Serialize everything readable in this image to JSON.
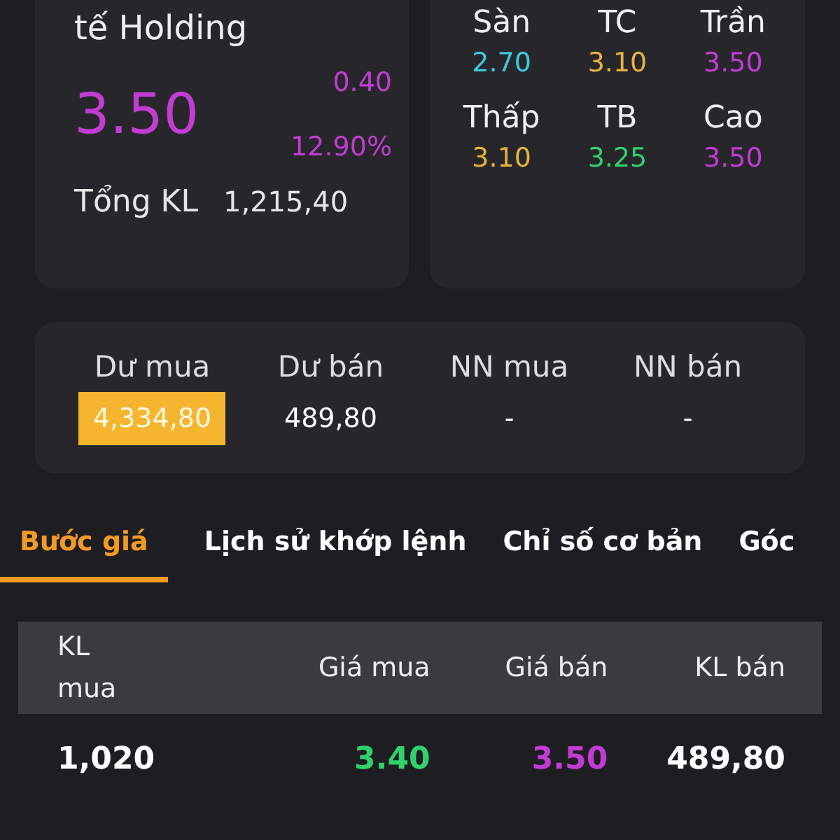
{
  "quote": {
    "name": "tế Holding",
    "price": {
      "text": "3.50",
      "kind": "ceiling"
    },
    "change": {
      "text": "0.40",
      "kind": "ceiling"
    },
    "percent": {
      "text": "12.90%",
      "kind": "ceiling"
    },
    "volume_label": "Tổng KL",
    "volume": "1,215,40"
  },
  "price_levels": [
    {
      "label": "Sàn",
      "value": "2.70",
      "kind": "floor"
    },
    {
      "label": "TC",
      "value": "3.10",
      "kind": "reference"
    },
    {
      "label": "Trần",
      "value": "3.50",
      "kind": "ceiling"
    },
    {
      "label": "Thấp",
      "value": "3.10",
      "kind": "reference"
    },
    {
      "label": "TB",
      "value": "3.25",
      "kind": "up"
    },
    {
      "label": "Cao",
      "value": "3.50",
      "kind": "ceiling"
    }
  ],
  "balances": [
    {
      "label": "Dư mua",
      "value": "4,334,80",
      "highlighted": true
    },
    {
      "label": "Dư bán",
      "value": "489,80",
      "highlighted": false
    },
    {
      "label": "NN mua",
      "value": "-",
      "highlighted": false
    },
    {
      "label": "NN bán",
      "value": "-",
      "highlighted": false
    }
  ],
  "tabs": [
    {
      "label": "Bước giá",
      "selected": true
    },
    {
      "label": "Lịch sử khớp lệnh",
      "selected": false
    },
    {
      "label": "Chỉ số cơ bản",
      "selected": false
    },
    {
      "label": "Góc",
      "selected": false
    }
  ],
  "table": {
    "columns": [
      "KL mua",
      "Giá mua",
      "Giá bán",
      "KL bán"
    ],
    "rows": [
      [
        {
          "text": "1,020",
          "kind": "plain"
        },
        {
          "text": "3.40",
          "kind": "up"
        },
        {
          "text": "3.50",
          "kind": "ceiling"
        },
        {
          "text": "489,80",
          "kind": "plain"
        }
      ]
    ]
  }
}
